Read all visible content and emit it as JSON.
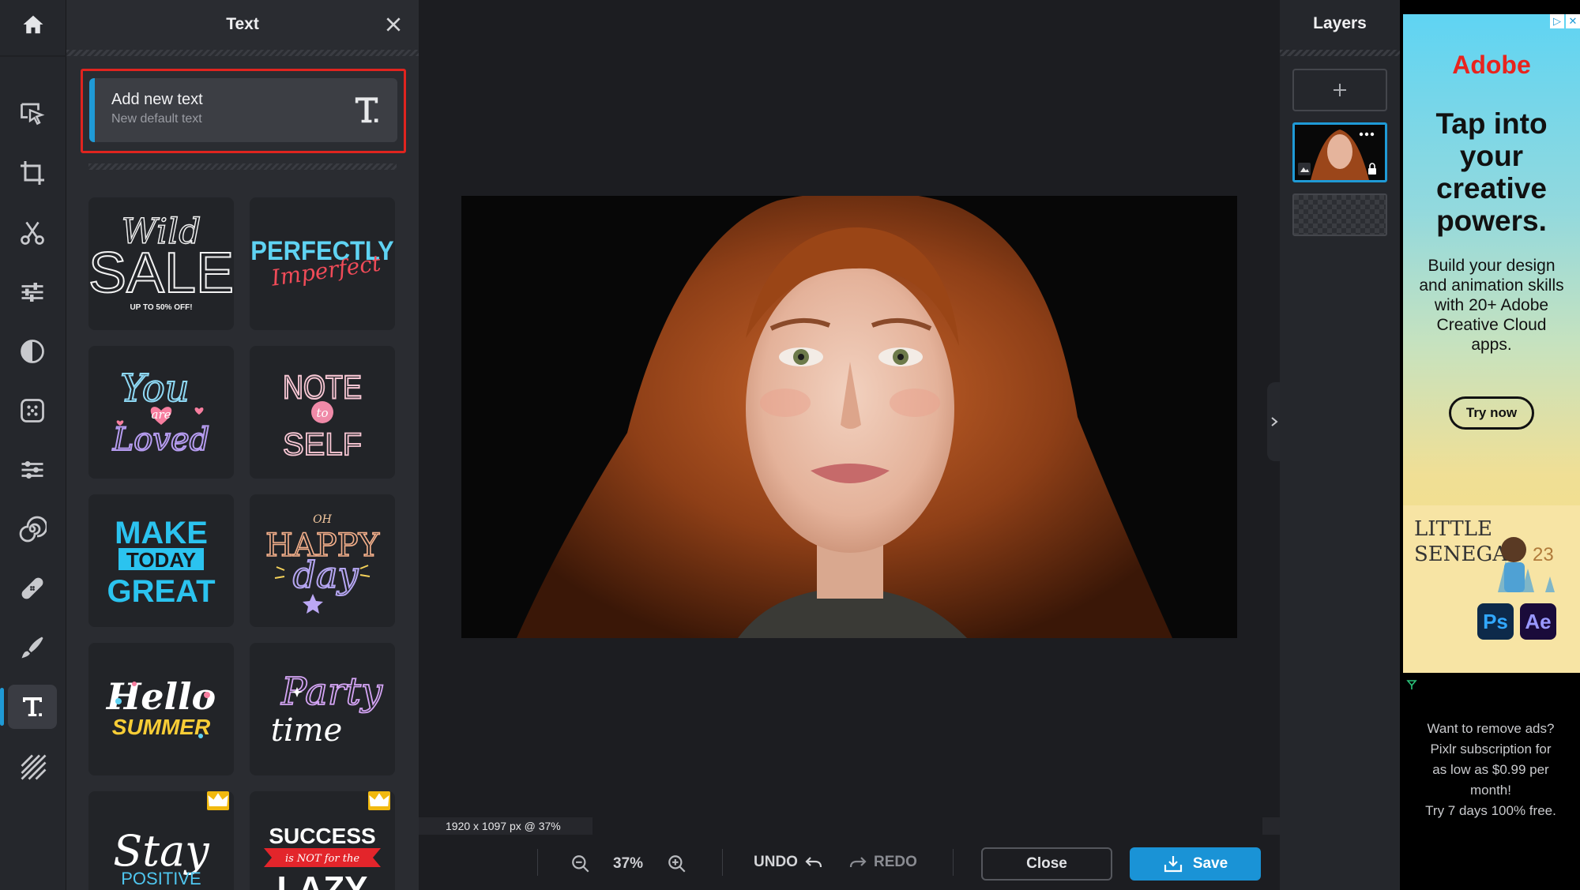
{
  "rail": {
    "tools": [
      "home",
      "arrange",
      "crop",
      "cutout",
      "adjust",
      "filter",
      "effect",
      "liquify",
      "retouch",
      "heal",
      "draw",
      "text",
      "pattern"
    ]
  },
  "text_panel": {
    "title": "Text",
    "add_new_text": {
      "title": "Add new text",
      "subtitle": "New default text"
    },
    "presets": [
      {
        "id": "wild-sale",
        "lines": [
          "Wild",
          "SALE",
          "UP TO 50% OFF!"
        ],
        "premium": false
      },
      {
        "id": "perfectly-imperfect",
        "lines": [
          "PERFECTLY",
          "Imperfect"
        ],
        "premium": false
      },
      {
        "id": "you-are-loved",
        "lines": [
          "You",
          "are",
          "Loved"
        ],
        "premium": false
      },
      {
        "id": "note-to-self",
        "lines": [
          "NOTE",
          "to",
          "SELF"
        ],
        "premium": false
      },
      {
        "id": "make-today-great",
        "lines": [
          "MAKE",
          "TODAY",
          "GREAT"
        ],
        "premium": false
      },
      {
        "id": "oh-happy-day",
        "lines": [
          "OH",
          "HAPPY",
          "day"
        ],
        "premium": false
      },
      {
        "id": "hello-summer",
        "lines": [
          "Hello",
          "SUMMER"
        ],
        "premium": false
      },
      {
        "id": "party-time",
        "lines": [
          "Party",
          "time"
        ],
        "premium": false
      },
      {
        "id": "stay-positive",
        "lines": [
          "Stay",
          "POSITIVE"
        ],
        "premium": true
      },
      {
        "id": "success-lazy",
        "lines": [
          "SUCCESS",
          "is NOT for the",
          "LAZY"
        ],
        "premium": true
      }
    ]
  },
  "canvas": {
    "status": "1920 x 1097 px @ 37%"
  },
  "bottom_bar": {
    "zoom": "37%",
    "undo": "UNDO",
    "redo": "REDO",
    "close": "Close",
    "save": "Save"
  },
  "layers": {
    "title": "Layers"
  },
  "ad": {
    "brand": "Adobe",
    "headline": [
      "Tap into",
      "your",
      "creative",
      "powers."
    ],
    "body": "Build your design and animation skills with 20+ Adobe Creative Cloud apps.",
    "cta": "Try now",
    "art_text": [
      "LITTLE",
      "SENEGAL",
      "23"
    ],
    "apps": [
      "Ps",
      "Ae"
    ],
    "remove_ads_note": [
      "Want to remove ads?",
      "Pixlr subscription for",
      "as low as $0.99 per",
      "month!",
      "Try 7 days 100% free."
    ]
  },
  "colors": {
    "accent": "#1f9ad6",
    "highlight_border": "#e0241f",
    "premium_badge": "#f1b90f"
  }
}
